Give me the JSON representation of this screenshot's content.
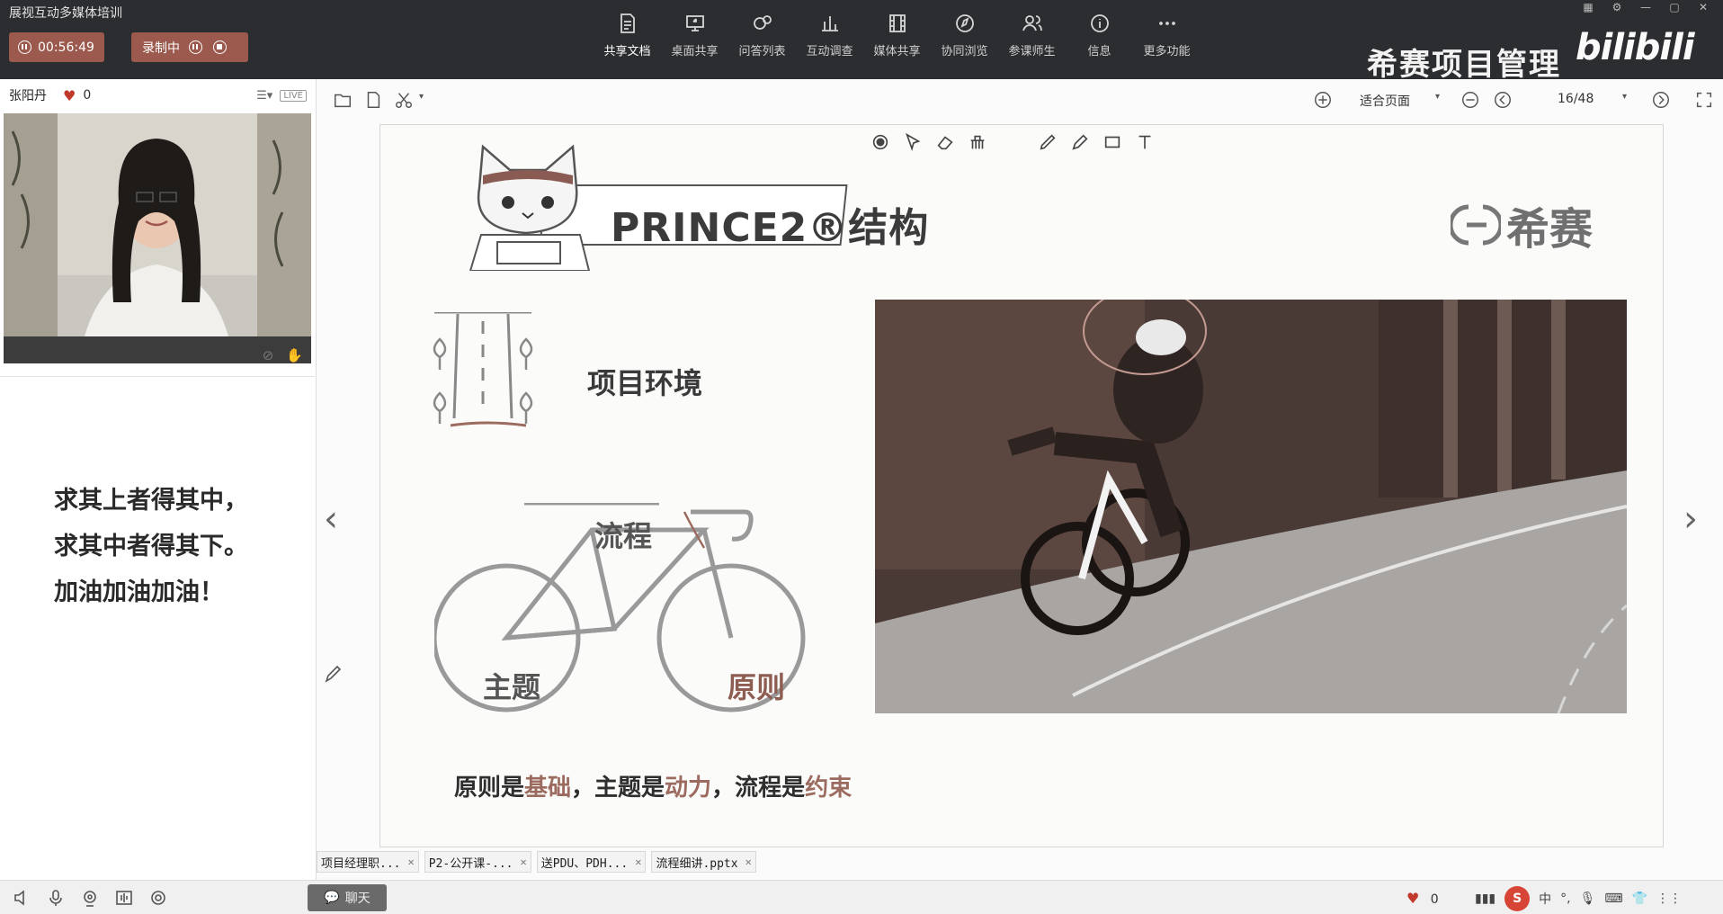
{
  "app": {
    "title": "展视互动多媒体培训",
    "timer": "00:56:49",
    "recording_label": "录制中",
    "brand": "希赛项目管理",
    "watermark": "bilibili"
  },
  "toolbar": {
    "items": [
      {
        "label": "共享文档",
        "icon": "document-icon",
        "active": true
      },
      {
        "label": "桌面共享",
        "icon": "desktop-share-icon"
      },
      {
        "label": "问答列表",
        "icon": "qa-list-icon"
      },
      {
        "label": "互动调查",
        "icon": "survey-icon"
      },
      {
        "label": "媒体共享",
        "icon": "media-share-icon"
      },
      {
        "label": "协同浏览",
        "icon": "co-browse-icon"
      },
      {
        "label": "参课师生",
        "icon": "participants-icon"
      },
      {
        "label": "信息",
        "icon": "info-icon"
      },
      {
        "label": "更多功能",
        "icon": "more-icon"
      }
    ]
  },
  "presenter": {
    "name": "张阳丹",
    "likes": "0",
    "live_badge": "LIVE"
  },
  "notes": {
    "lines": [
      "求其上者得其中，",
      "求其中者得其下。",
      "加油加油加油！"
    ]
  },
  "doc_toolbar": {
    "fit_label": "适合页面",
    "page": "16/48"
  },
  "slide": {
    "title": "PRINCE2®结构",
    "logo_text": "希赛",
    "environment_label": "项目环境",
    "flow_label": "流程",
    "topic_label": "主题",
    "principle_label": "原则",
    "caption": {
      "p1": "原则是",
      "h1": "基础",
      "p2": "，主题是",
      "h2": "动力",
      "p3": "，流程是",
      "h3": "约束"
    }
  },
  "tabs": [
    {
      "label": "项目经理职..."
    },
    {
      "label": "P2-公开课-..."
    },
    {
      "label": "送PDU、PDH..."
    },
    {
      "label": "流程细讲.pptx"
    }
  ],
  "bottom": {
    "chat_label": "聊天",
    "likes": "0",
    "ime_label": "中"
  },
  "colors": {
    "topbar": "#2c2d30",
    "record_button": "#9b5a4d",
    "accent_text": "#9c6b5f"
  }
}
